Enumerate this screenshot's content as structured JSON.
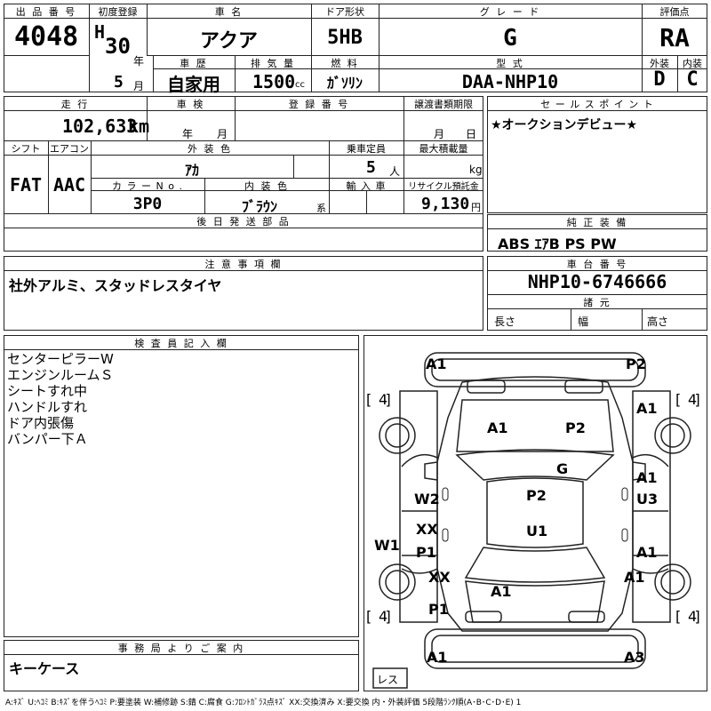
{
  "lot": {
    "label": "出 品 番 号",
    "value": "4048"
  },
  "first_reg": {
    "label": "初度登録",
    "era": "H",
    "year": "30",
    "year_unit": "年",
    "month": "5",
    "month_unit": "月"
  },
  "car_name": {
    "label": "車 名",
    "value": "アクア"
  },
  "door": {
    "label": "ドア形状",
    "value": "5HB"
  },
  "grade": {
    "label": "グ レ ー ド",
    "value": "G"
  },
  "score": {
    "label": "評価点",
    "value": "RA",
    "ext_label": "外装",
    "int_label": "内装",
    "ext_value": "D",
    "int_value": "C"
  },
  "history": {
    "label": "車 歴",
    "value": "自家用"
  },
  "displacement": {
    "label": "排 気 量",
    "value": "1500",
    "unit": "cc"
  },
  "fuel": {
    "label": "燃 料",
    "value": "ｶﾞｿﾘﾝ"
  },
  "model": {
    "label": "型 式",
    "value": "DAA-NHP10"
  },
  "mileage": {
    "label": "走 行",
    "value": "102,633",
    "unit": "km"
  },
  "inspection": {
    "label": "車 検",
    "year_unit": "年",
    "month_unit": "月"
  },
  "registration": {
    "label": "登 録 番 号"
  },
  "transfer": {
    "label": "譲渡書類期限",
    "month_unit": "月",
    "day_unit": "日"
  },
  "sales_point": {
    "label": "セ ー ル ス ポ イ ン ト",
    "value": "★オークションデビュー★"
  },
  "shift": {
    "label": "シフト",
    "value": "FAT"
  },
  "aircon": {
    "label": "エアコン",
    "value": "AAC"
  },
  "ext_color": {
    "label": "外 装 色",
    "value": "ｱｶ"
  },
  "capacity": {
    "label": "乗車定員",
    "value": "5",
    "unit": "人"
  },
  "max_load": {
    "label": "最大積載量",
    "unit": "kg"
  },
  "color_no": {
    "label": "カ ラ ー N o .",
    "value": "3P0"
  },
  "int_color": {
    "label": "内 装 色",
    "value": "ﾌﾞﾗｳﾝ",
    "unit": "系"
  },
  "import": {
    "label": "輸 入 車"
  },
  "recycle": {
    "label": "リサイクル預託金",
    "value": "9,130",
    "unit": "円"
  },
  "later_parts": {
    "label": "後 日 発 送 部 品"
  },
  "genuine": {
    "label": "純 正 装 備",
    "value": "ABS ｴｱB PS PW"
  },
  "notes": {
    "label": "注 意 事 項 欄",
    "value": "社外アルミ、スタッドレスタイヤ"
  },
  "chassis": {
    "label": "車 台 番 号",
    "value": "NHP10-6746666"
  },
  "specs": {
    "label": "諸 元",
    "length": "長さ",
    "width": "幅",
    "height": "高さ"
  },
  "inspector": {
    "label": "検 査 員 記 入 欄",
    "lines": [
      "センターピラーW",
      "エンジンルームＳ",
      "シートすれ中",
      "ハンドルすれ",
      "ドア内張傷",
      "バンパー下Ａ"
    ]
  },
  "office": {
    "label": "事 務 局 よ り ご 案 内",
    "value": "キーケース"
  },
  "diagram": {
    "front_left": "A1",
    "front_right": "P2",
    "hood_left": "A1",
    "hood_right": "P2",
    "windshield": "G",
    "roof": "P2",
    "roof_lower": "U1",
    "left_front_door": "W2",
    "left_rear_door_upper": "XX",
    "left_rear_door_lower": "P1",
    "left_rocker": "W1",
    "left_quarter_upper": "XX",
    "left_quarter_lower": "P1",
    "right_fender": "A1",
    "right_front_door_upper": "A1",
    "right_front_door_lower": "U3",
    "right_rear_door": "A1",
    "right_quarter": "A1",
    "trunk": "A1",
    "rear_left": "A1",
    "rear_right": "A3",
    "tire_fl": "4",
    "tire_fr": "4",
    "tire_rl": "4",
    "tire_rr": "4",
    "spare": "レス"
  },
  "legend": "A:ｷｽﾞ  U:ﾍｺﾐ  B:ｷｽﾞを伴うﾍｺﾐ  P:要塗装  W:補修跡  S:錆  C:腐食  G:ﾌﾛﾝﾄｶﾞﾗｽ点ｷｽﾞ  XX:交換済み  X:要交換   内・外装評価  5段階ﾗﾝｸ順(A･B･C･D･E) 1"
}
